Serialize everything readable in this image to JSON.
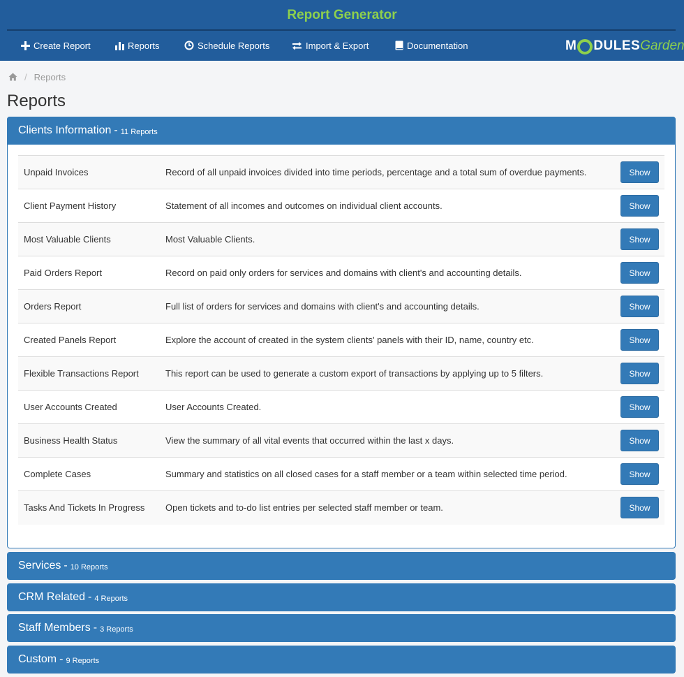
{
  "header": {
    "app_title": "Report Generator",
    "title_color": "#8ed04d",
    "bar_color": "#225d9c",
    "nav": [
      {
        "label": "Create Report",
        "icon": "plus-icon"
      },
      {
        "label": "Reports",
        "icon": "bar-chart-icon"
      },
      {
        "label": "Schedule Reports",
        "icon": "clock-icon"
      },
      {
        "label": "Import & Export",
        "icon": "swap-arrows-icon"
      },
      {
        "label": "Documentation",
        "icon": "book-icon"
      }
    ],
    "logo": {
      "part1": "M",
      "part2": "DULES",
      "part3": "Garden"
    }
  },
  "breadcrumb": {
    "items": [
      "Reports"
    ],
    "home_icon": "home-icon"
  },
  "page": {
    "title": "Reports"
  },
  "panels": [
    {
      "title": "Clients Information",
      "count": "11 Reports",
      "expanded": true,
      "rows": [
        {
          "name": "Unpaid Invoices",
          "description": "Record of all unpaid invoices divided into time periods, percentage and a total sum of overdue payments.",
          "button": "Show"
        },
        {
          "name": "Client Payment History",
          "description": "Statement of all incomes and outcomes on individual client accounts.",
          "button": "Show"
        },
        {
          "name": "Most Valuable Clients",
          "description": "Most Valuable Clients.",
          "button": "Show"
        },
        {
          "name": "Paid Orders Report",
          "description": "Record on paid only orders for services and domains with client's and accounting details.",
          "button": "Show"
        },
        {
          "name": "Orders Report",
          "description": "Full list of orders for services and domains with client's and accounting details.",
          "button": "Show"
        },
        {
          "name": "Created Panels Report",
          "description": "Explore the account of created in the system clients' panels with their ID, name, country etc.",
          "button": "Show"
        },
        {
          "name": "Flexible Transactions Report",
          "description": "This report can be used to generate a custom export of transactions by applying up to 5 filters.",
          "button": "Show"
        },
        {
          "name": "User Accounts Created",
          "description": "User Accounts Created.",
          "button": "Show"
        },
        {
          "name": "Business Health Status",
          "description": "View the summary of all vital events that occurred within the last x days.",
          "button": "Show"
        },
        {
          "name": "Complete Cases",
          "description": "Summary and statistics on all closed cases for a staff member or a team within selected time period.",
          "button": "Show"
        },
        {
          "name": "Tasks And Tickets In Progress",
          "description": "Open tickets and to-do list entries per selected staff member or team.",
          "button": "Show"
        }
      ]
    },
    {
      "title": "Services",
      "count": "10 Reports",
      "expanded": false
    },
    {
      "title": "CRM Related",
      "count": "4 Reports",
      "expanded": false
    },
    {
      "title": "Staff Members",
      "count": "3 Reports",
      "expanded": false
    },
    {
      "title": "Custom",
      "count": "9 Reports",
      "expanded": false
    }
  ],
  "colors": {
    "primary": "#337ab7",
    "accent": "#8ed04d"
  }
}
